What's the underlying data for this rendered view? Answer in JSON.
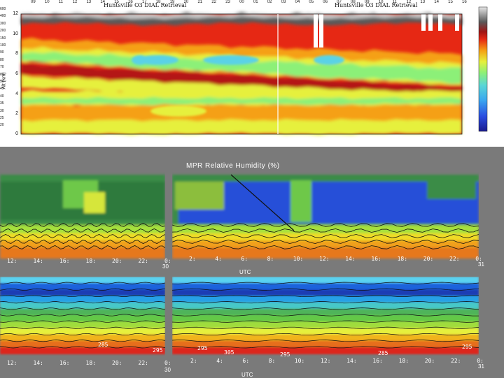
{
  "top": {
    "title_left": "Huntsville O3 DIAL Retrieval",
    "title_right": "Huntsville O3 DIAL Retrieval",
    "ylabel": "Alt (km)",
    "yticks": [
      "12",
      "10",
      "8",
      "6",
      "4",
      "2",
      "0"
    ],
    "xticks": [
      "09",
      "10",
      "11",
      "12",
      "13",
      "14",
      "15",
      "16",
      "17",
      "18",
      "19",
      "20",
      "21",
      "22",
      "23",
      "00",
      "01",
      "02",
      "03",
      "04",
      "05",
      "06",
      "07",
      "08",
      "09",
      "10",
      "11",
      "12",
      "13",
      "14",
      "15",
      "16"
    ],
    "colorbar_labels": [
      "600",
      "400",
      "300",
      "200",
      "150",
      "100",
      "90",
      "80",
      "70",
      "60",
      "50",
      "45",
      "40",
      "35",
      "30",
      "25",
      "20"
    ]
  },
  "mid": {
    "title": "MPR Relative Humidity (%)",
    "xticks_left": [
      "12:",
      "14:",
      "16:",
      "18:",
      "20:",
      "22:",
      "0:"
    ],
    "xticks_right": [
      "2:",
      "4:",
      "6:",
      "8:",
      "10:",
      "12:",
      "14:",
      "16:",
      "18:",
      "20:",
      "22:",
      "0:"
    ],
    "day_left": "30",
    "day_right": "31",
    "xlabel": "UTC"
  },
  "bottom": {
    "xticks_left": [
      "12:",
      "14:",
      "16:",
      "18:",
      "20:",
      "22:",
      "0:"
    ],
    "xticks_right": [
      "2:",
      "4:",
      "6:",
      "8:",
      "10:",
      "12:",
      "14:",
      "16:",
      "18:",
      "20:",
      "22:",
      "0:"
    ],
    "day_left": "30",
    "day_right": "31",
    "xlabel": "UTC",
    "contour_labels": [
      "285",
      "295",
      "295",
      "305",
      "295",
      "285",
      "295"
    ]
  },
  "chart_data": [
    {
      "type": "heatmap",
      "title": "Huntsville O3 DIAL Retrieval",
      "xlabel": "",
      "ylabel": "Alt (km)",
      "ylim": [
        0,
        12
      ],
      "colors": [
        "#1e28c8",
        "#3c8cf0",
        "#5ad2e6",
        "#8cf078",
        "#e6f03c",
        "#f5a014",
        "#e62814",
        "#b41414",
        "#5a5a5a",
        "#c8c8c8"
      ]
    },
    {
      "type": "heatmap",
      "title": "MPR Relative Humidity (%)",
      "xlabel": "UTC"
    },
    {
      "type": "heatmap",
      "title": "",
      "xlabel": "UTC"
    }
  ]
}
